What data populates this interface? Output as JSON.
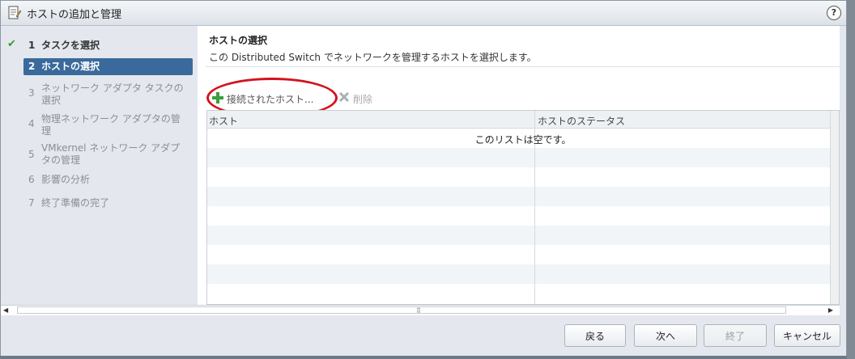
{
  "window": {
    "title": "ホストの追加と管理",
    "help": "?"
  },
  "steps": [
    {
      "num": "1",
      "label": "タスクを選択",
      "state": "done"
    },
    {
      "num": "2",
      "label": "ホストの選択",
      "state": "active"
    },
    {
      "num": "3",
      "label": "ネットワーク アダプタ タスクの選択",
      "state": "disabled"
    },
    {
      "num": "4",
      "label": "物理ネットワーク アダプタの管理",
      "state": "disabled"
    },
    {
      "num": "5",
      "label": "VMkernel ネットワーク アダプタの管理",
      "state": "disabled"
    },
    {
      "num": "6",
      "label": "影響の分析",
      "state": "disabled"
    },
    {
      "num": "7",
      "label": "終了準備の完了",
      "state": "disabled"
    }
  ],
  "main": {
    "title": "ホストの選択",
    "description": "この Distributed Switch でネットワークを管理するホストを選択します。",
    "toolbar": {
      "add_label": "接続されたホスト...",
      "remove_label": "削除"
    },
    "table": {
      "columns": [
        "ホスト",
        "ホストのステータス"
      ],
      "empty_text": "このリストは空です。"
    }
  },
  "footer": {
    "back": "戻る",
    "next": "次へ",
    "finish": "終了",
    "cancel": "キャンセル"
  },
  "colors": {
    "accent": "#3a6a9c",
    "highlight": "#d3131c",
    "add_icon": "#3aa03a"
  }
}
